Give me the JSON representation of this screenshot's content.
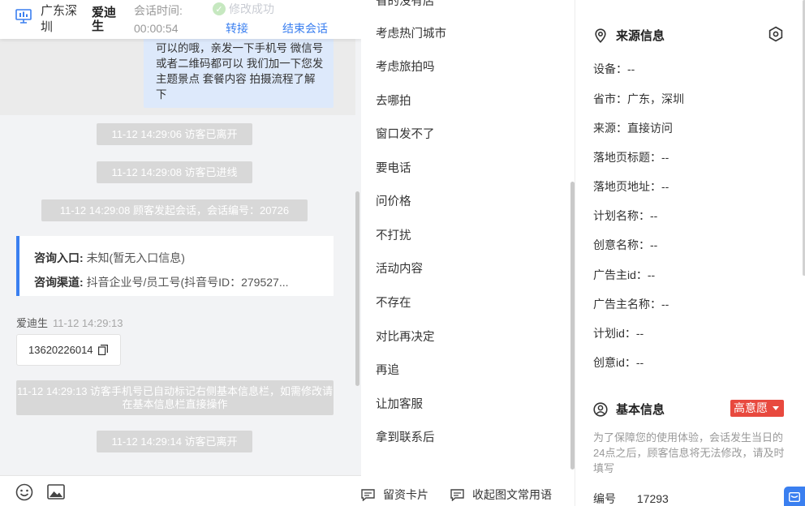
{
  "chat": {
    "header": {
      "location": "广东深圳",
      "visitor_name": "爱迪生",
      "session_time_label": "会话时间:",
      "session_time": "00:00:54",
      "toast": "修改成功",
      "transfer": "转接",
      "end_session": "结束会话"
    },
    "agent_message": "可以的哦，亲发一下手机号 微信号或者二维码都可以 我们加一下您发主题景点 套餐内容 拍摄流程了解下",
    "system_messages": [
      "11-12 14:29:06 访客已离开",
      "11-12 14:29:08 访客已进线",
      "11-12 14:29:08 顾客发起会话，会话编号：20726"
    ],
    "info_card": {
      "entry_label": "咨询入口:",
      "entry_value": "未知(暂无入口信息)",
      "channel_label": "咨询渠道:",
      "channel_value": "抖音企业号/员工号(抖音号ID：279527..."
    },
    "visitor_message": {
      "name": "爱迪生",
      "time": "11-12 14:29:13",
      "phone": "13620226014"
    },
    "auto_tag_message": "11-12 14:29:13 访客手机号已自动标记右侧基本信息栏，如需修改请在基本信息栏直接操作",
    "left_message": "11-12 14:29:14 访客已离开",
    "faded_text": "…"
  },
  "quick_replies": {
    "items": [
      "省的没有店",
      "考虑热门城市",
      "考虑旅拍吗",
      "去哪拍",
      "窗口发不了",
      "要电话",
      "问价格",
      "不打扰",
      "活动内容",
      "不存在",
      "对比再决定",
      "再追",
      "让加客服",
      "拿到联系后"
    ],
    "leave_card": "留资卡片",
    "collapse": "收起图文常用语"
  },
  "info_panel": {
    "source_title": "来源信息",
    "source_fields": [
      "设备：--",
      "省市：广东，深圳",
      "来源：直接访问",
      "落地页标题：--",
      "落地页地址：--",
      "计划名称：--",
      "创意名称：--",
      "广告主id：--",
      "广告主名称：--",
      "计划id：--",
      "创意id：--"
    ],
    "basic_title": "基本信息",
    "intent": "高意愿",
    "notice": "为了保障您的使用体验，会话发生当日的24点之后，顾客信息将无法修改，请及时填写",
    "id_label": "编号",
    "id_value": "17293"
  },
  "colors": {
    "accent": "#3a7ff0",
    "badge": "#e8493e",
    "agent_bubble": "#dde9fb"
  }
}
